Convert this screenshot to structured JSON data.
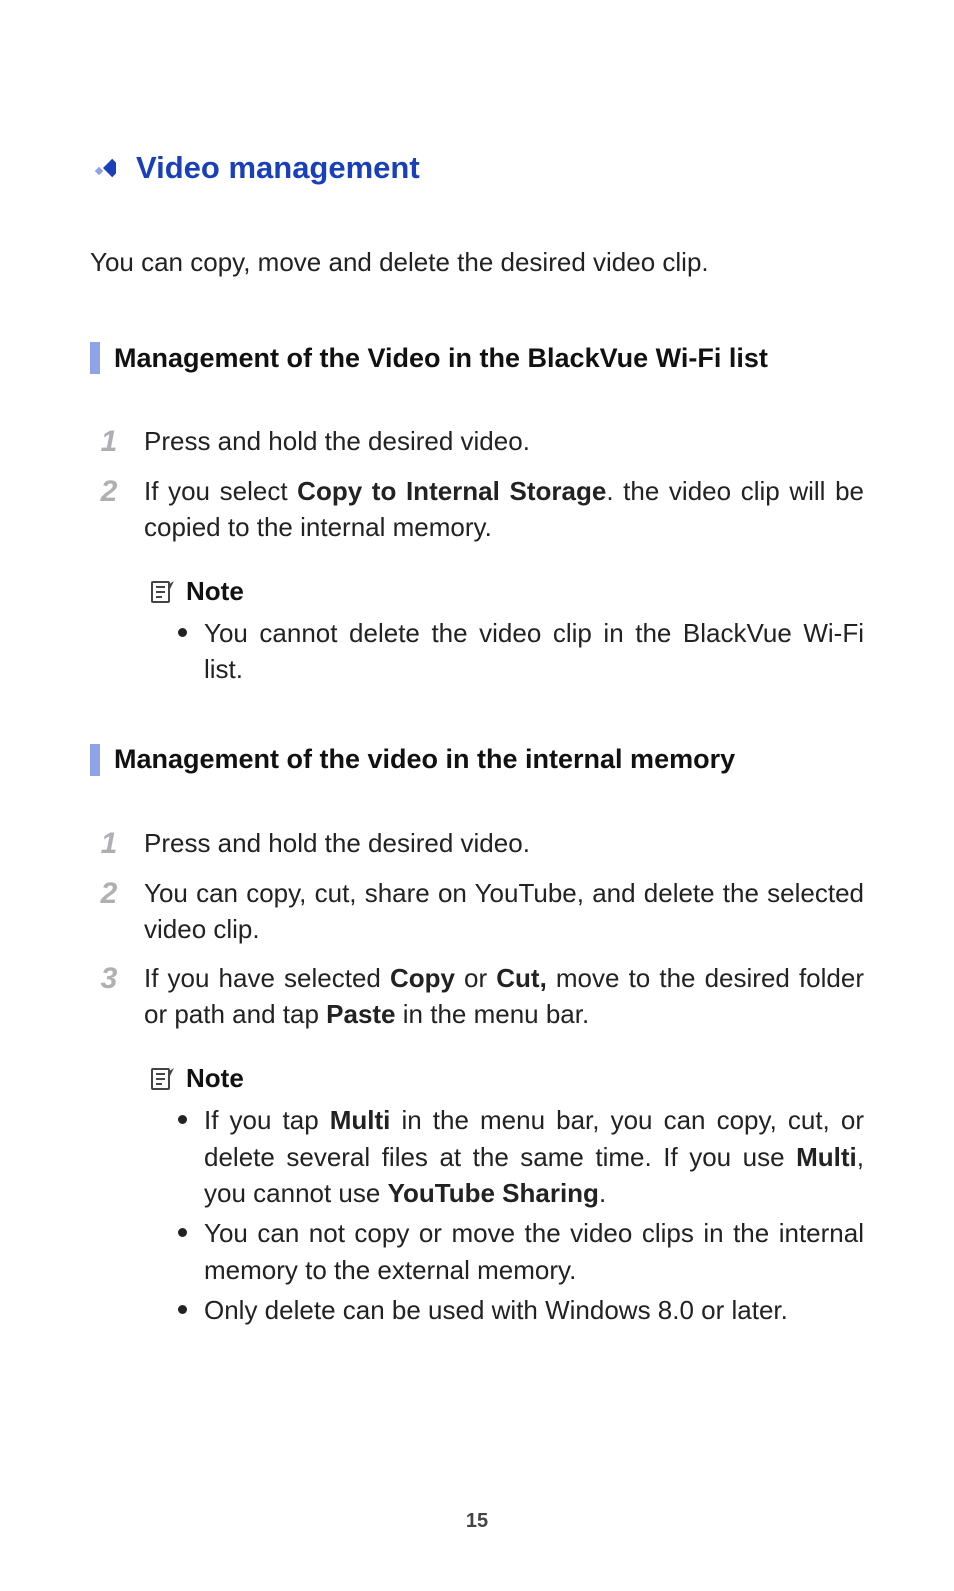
{
  "heading": "Video management",
  "intro": "You can copy, move and delete the desired video clip.",
  "sections": [
    {
      "title": "Management of the Video in the BlackVue Wi-Fi list",
      "steps": [
        {
          "num": "1",
          "text_plain": "Press and hold the desired video."
        },
        {
          "num": "2",
          "pre": "If you select ",
          "bold1": "Copy to Internal Storage",
          "post": ". the video clip will be copied to the internal memory."
        }
      ],
      "note": {
        "label": "Note",
        "items": [
          {
            "text_plain": "You cannot delete the video clip in the BlackVue Wi-Fi list."
          }
        ]
      }
    },
    {
      "title": "Management of the video in the internal memory",
      "steps": [
        {
          "num": "1",
          "text_plain": "Press and hold the desired video."
        },
        {
          "num": "2",
          "text_plain": "You can copy, cut, share on YouTube, and delete the selected video clip."
        },
        {
          "num": "3",
          "pre": "If you have selected ",
          "bold1": "Copy",
          "mid1": " or ",
          "bold2": "Cut,",
          "mid2": " move to the desired folder or path and tap ",
          "bold3": "Paste",
          "post": " in the menu bar."
        }
      ],
      "note": {
        "label": "Note",
        "items": [
          {
            "pre": "If you tap ",
            "bold1": "Multi",
            "mid1": " in the menu bar, you can copy, cut, or delete several files at the same time. If you use ",
            "bold2": "Multi",
            "mid2": ", you cannot use ",
            "bold3": "YouTube Sharing",
            "post": "."
          },
          {
            "text_plain": "You can not copy or move the video clips in the internal memory to the external memory."
          },
          {
            "text_plain": "Only delete can be used with Windows 8.0 or later."
          }
        ]
      }
    }
  ],
  "page_number": "15",
  "colors": {
    "heading_blue": "#1a3fba",
    "subheading_bar": "#8fa4e8",
    "step_num_grey": "#aeb0b3"
  }
}
